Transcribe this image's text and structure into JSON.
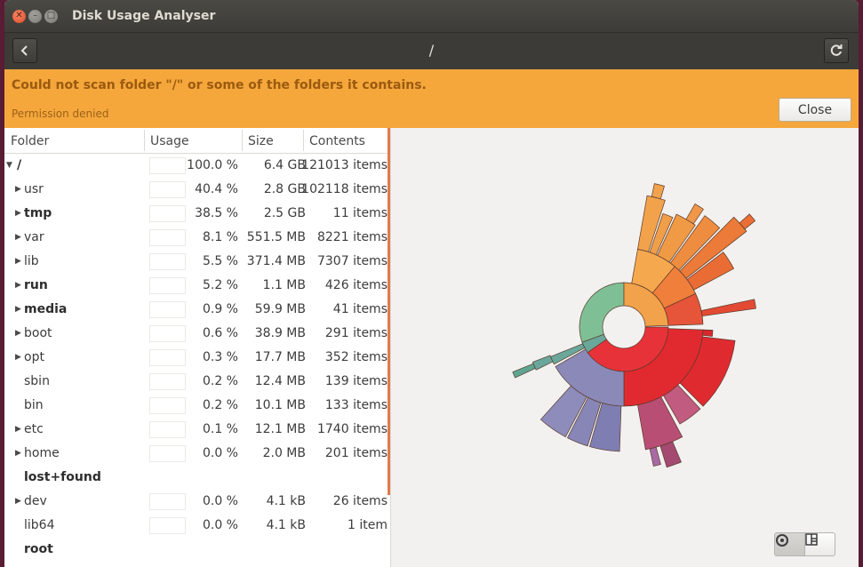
{
  "window": {
    "title": "Disk Usage Analyser"
  },
  "header": {
    "path": "/",
    "back_icon": "chevron-left-icon",
    "refresh_icon": "refresh-icon"
  },
  "infobar": {
    "message": "Could not scan folder \"/\" or some of the folders it contains.",
    "detail": "Permission denied",
    "close_label": "Close"
  },
  "tree": {
    "columns": [
      "Folder",
      "Usage",
      "Size",
      "Contents"
    ],
    "rows": [
      {
        "name": "/",
        "expander": "open",
        "bold": true,
        "usage": "100.0 %",
        "size": "6.4 GB",
        "contents": "121013 items",
        "indent": 0
      },
      {
        "name": "usr",
        "expander": "closed",
        "bold": false,
        "usage": "40.4 %",
        "size": "2.8 GB",
        "contents": "102118 items",
        "indent": 1
      },
      {
        "name": "tmp",
        "expander": "closed",
        "bold": true,
        "usage": "38.5 %",
        "size": "2.5 GB",
        "contents": "11 items",
        "indent": 1
      },
      {
        "name": "var",
        "expander": "closed",
        "bold": false,
        "usage": "8.1 %",
        "size": "551.5 MB",
        "contents": "8221 items",
        "indent": 1
      },
      {
        "name": "lib",
        "expander": "closed",
        "bold": false,
        "usage": "5.5 %",
        "size": "371.4 MB",
        "contents": "7307 items",
        "indent": 1
      },
      {
        "name": "run",
        "expander": "closed",
        "bold": true,
        "usage": "5.2 %",
        "size": "1.1 MB",
        "contents": "426 items",
        "indent": 1
      },
      {
        "name": "media",
        "expander": "closed",
        "bold": true,
        "usage": "0.9 %",
        "size": "59.9 MB",
        "contents": "41 items",
        "indent": 1
      },
      {
        "name": "boot",
        "expander": "closed",
        "bold": false,
        "usage": "0.6 %",
        "size": "38.9 MB",
        "contents": "291 items",
        "indent": 1
      },
      {
        "name": "opt",
        "expander": "closed",
        "bold": false,
        "usage": "0.3 %",
        "size": "17.7 MB",
        "contents": "352 items",
        "indent": 1
      },
      {
        "name": "sbin",
        "expander": "none",
        "bold": false,
        "usage": "0.2 %",
        "size": "12.4 MB",
        "contents": "139 items",
        "indent": 1
      },
      {
        "name": "bin",
        "expander": "none",
        "bold": false,
        "usage": "0.2 %",
        "size": "10.1 MB",
        "contents": "133 items",
        "indent": 1
      },
      {
        "name": "etc",
        "expander": "closed",
        "bold": false,
        "usage": "0.1 %",
        "size": "12.1 MB",
        "contents": "1740 items",
        "indent": 1
      },
      {
        "name": "home",
        "expander": "closed",
        "bold": false,
        "usage": "0.0 %",
        "size": "2.0 MB",
        "contents": "201 items",
        "indent": 1
      },
      {
        "name": "lost+found",
        "expander": "none",
        "bold": true,
        "usage": "",
        "size": "",
        "contents": "",
        "indent": 1,
        "no_usage_box": true
      },
      {
        "name": "dev",
        "expander": "closed",
        "bold": false,
        "usage": "0.0 %",
        "size": "4.1 kB",
        "contents": "26 items",
        "indent": 1
      },
      {
        "name": "lib64",
        "expander": "none",
        "bold": false,
        "usage": "0.0 %",
        "size": "4.1 kB",
        "contents": "1 item",
        "indent": 1
      },
      {
        "name": "root",
        "expander": "none",
        "bold": true,
        "usage": "",
        "size": "",
        "contents": "",
        "indent": 1,
        "no_usage_box": true
      }
    ]
  },
  "chart": {
    "view_toggle": {
      "ring_icon": "ring-chart-icon",
      "treemap_icon": "treemap-icon"
    },
    "colors": {
      "center": "#d8d8d6",
      "usr": "#e8323a",
      "tmp": "#8a89b8",
      "var_lib": "#f2a24a",
      "green": "#7fbf95",
      "teal": "#6aa79b",
      "pink": "#c25b80"
    }
  }
}
